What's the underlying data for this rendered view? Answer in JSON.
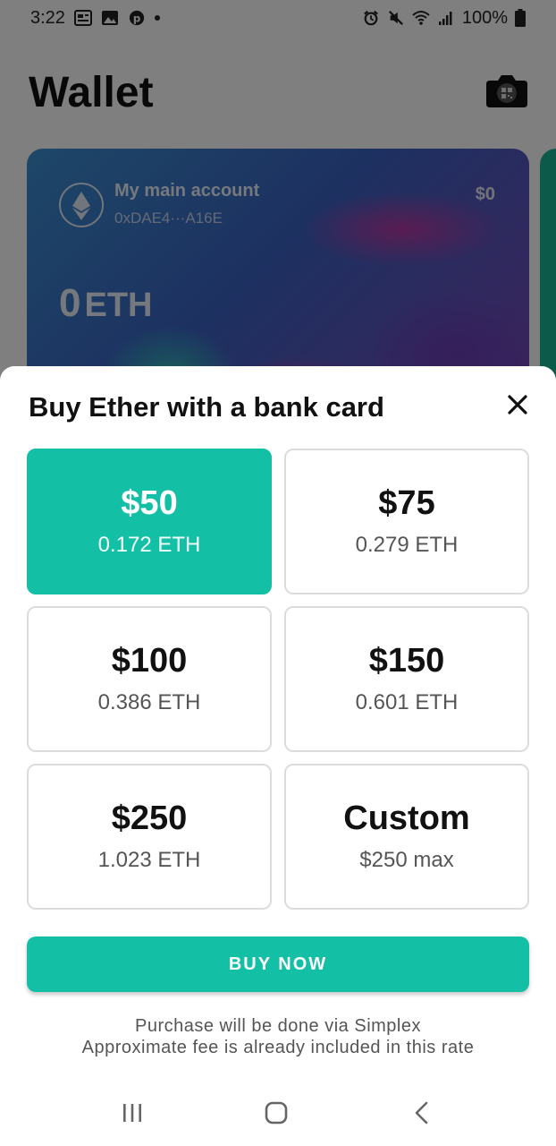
{
  "status_bar": {
    "time": "3:22",
    "battery": "100%"
  },
  "wallet": {
    "title": "Wallet",
    "account": {
      "name": "My main account",
      "address": "0xDAE4···A16E",
      "usd_balance": "$0",
      "eth_amount": "0",
      "eth_unit": "ETH"
    }
  },
  "sheet": {
    "title": "Buy Ether with a bank card",
    "options": [
      {
        "main": "$50",
        "sub": "0.172 ETH",
        "selected": true
      },
      {
        "main": "$75",
        "sub": "0.279 ETH",
        "selected": false
      },
      {
        "main": "$100",
        "sub": "0.386 ETH",
        "selected": false
      },
      {
        "main": "$150",
        "sub": "0.601 ETH",
        "selected": false
      },
      {
        "main": "$250",
        "sub": "1.023 ETH",
        "selected": false
      },
      {
        "main": "Custom",
        "sub": "$250 max",
        "selected": false
      }
    ],
    "buy_label": "BUY NOW",
    "footnote_line1": "Purchase will be done via Simplex",
    "footnote_line2": "Approximate fee is already included in this rate"
  },
  "colors": {
    "accent": "#14c0a5",
    "tile_border": "#dcdcdc",
    "text_dark": "#111111",
    "text_muted": "#555555"
  },
  "icons": {
    "close": "close-icon",
    "camera": "camera-qr-icon",
    "ethereum": "ethereum-icon",
    "nav_recents": "recents-icon",
    "nav_home": "home-icon",
    "nav_back": "back-icon"
  }
}
